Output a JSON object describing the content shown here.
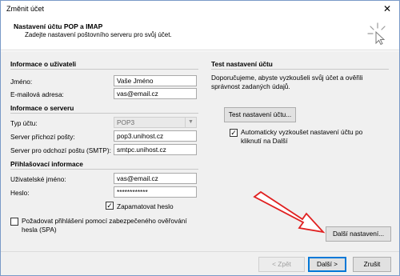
{
  "window": {
    "title": "Změnit účet",
    "close_glyph": "✕"
  },
  "header": {
    "title": "Nastavení účtu POP a IMAP",
    "subtitle": "Zadejte nastavení poštovního serveru pro svůj účet.",
    "icon": "cursor-sparkle-icon"
  },
  "user_info": {
    "heading": "Informace o uživateli",
    "name_label": "Jméno:",
    "name_value": "Vaše Jméno",
    "email_label": "E-mailová adresa:",
    "email_value": "vas@email.cz"
  },
  "server_info": {
    "heading": "Informace o serveru",
    "type_label": "Typ účtu:",
    "type_value": "POP3",
    "incoming_label": "Server příchozí pošty:",
    "incoming_value": "pop3.unihost.cz",
    "outgoing_label": "Server pro odchozí poštu (SMTP):",
    "outgoing_value": "smtpc.unihost.cz"
  },
  "login_info": {
    "heading": "Přihlašovací informace",
    "username_label": "Uživatelské jméno:",
    "username_value": "vas@email.cz",
    "password_label": "Heslo:",
    "password_value": "************",
    "remember_label": "Zapamatovat heslo",
    "remember_checked": true,
    "spa_label_line1": "Požadovat přihlášení pomocí zabezpečeného ověřování",
    "spa_label_line2": "hesla (SPA)",
    "spa_checked": false
  },
  "test": {
    "heading": "Test nastavení účtu",
    "desc_line1": "Doporučujeme, abyste vyzkoušeli svůj účet a ověřili",
    "desc_line2": "správnost zadaných údajů.",
    "button": "Test nastavení účtu...",
    "auto_line1": "Automaticky vyzkoušet nastavení účtu po",
    "auto_line2": "kliknutí na Další",
    "auto_checked": true
  },
  "more_settings_button": "Další nastavení...",
  "footer": {
    "back": "< Zpět",
    "next": "Další >",
    "cancel": "Zrušit"
  },
  "colors": {
    "accent": "#0078d7",
    "arrow_fill": "#ffffff",
    "arrow_stroke": "#e02020"
  }
}
